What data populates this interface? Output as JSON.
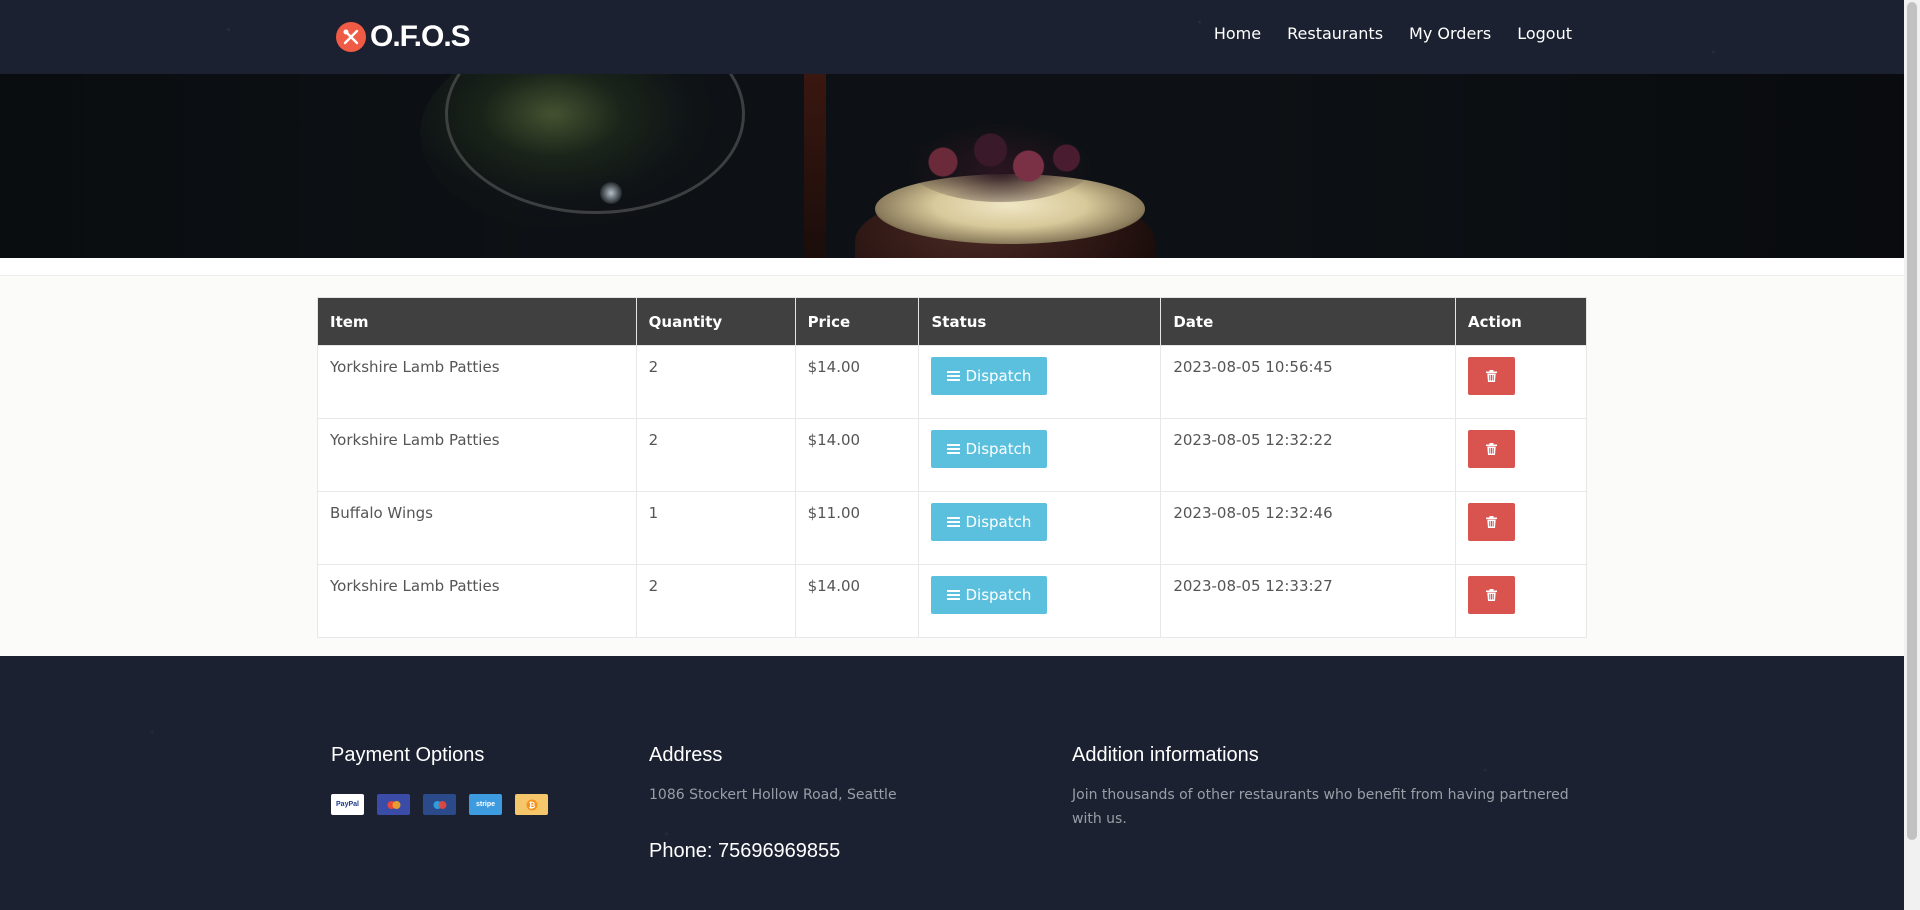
{
  "brand": {
    "name": "O.F.O.S"
  },
  "nav": [
    "Home",
    "Restaurants",
    "My Orders",
    "Logout"
  ],
  "table": {
    "headers": [
      "Item",
      "Quantity",
      "Price",
      "Status",
      "Date",
      "Action"
    ],
    "rows": [
      {
        "item": "Yorkshire Lamb Patties",
        "qty": "2",
        "price": "$14.00",
        "status": "Dispatch",
        "date": "2023-08-05 10:56:45"
      },
      {
        "item": "Yorkshire Lamb Patties",
        "qty": "2",
        "price": "$14.00",
        "status": "Dispatch",
        "date": "2023-08-05 12:32:22"
      },
      {
        "item": "Buffalo Wings",
        "qty": "1",
        "price": "$11.00",
        "status": "Dispatch",
        "date": "2023-08-05 12:32:46"
      },
      {
        "item": "Yorkshire Lamb Patties",
        "qty": "2",
        "price": "$14.00",
        "status": "Dispatch",
        "date": "2023-08-05 12:33:27"
      }
    ]
  },
  "footer": {
    "payment_title": "Payment Options",
    "payment_icons": [
      {
        "name": "paypal-icon",
        "label": "PayPal",
        "bg": "#ffffff",
        "fg": "#1e3a8a"
      },
      {
        "name": "mastercard-icon",
        "label": "",
        "bg": "#3b4ba8",
        "fg": "#ffffff"
      },
      {
        "name": "maestro-icon",
        "label": "",
        "bg": "#2a4a8a",
        "fg": "#ffffff"
      },
      {
        "name": "stripe-icon",
        "label": "stripe",
        "bg": "#3d9be0",
        "fg": "#ffffff"
      },
      {
        "name": "bitcoin-icon",
        "label": "",
        "bg": "#f6c66a",
        "fg": "#ffffff"
      }
    ],
    "address_title": "Address",
    "address": "1086 Stockert Hollow Road, Seattle",
    "phone": "Phone: 75696969855",
    "info_title": "Addition informations",
    "info_text": "Join thousands of other restaurants who benefit from having partnered with us."
  },
  "colors": {
    "header_bg": "#1b2130",
    "table_head_bg": "#404040",
    "dispatch_btn": "#5bc0de",
    "delete_btn": "#d9534f",
    "logo_accent": "#ef5b45"
  }
}
